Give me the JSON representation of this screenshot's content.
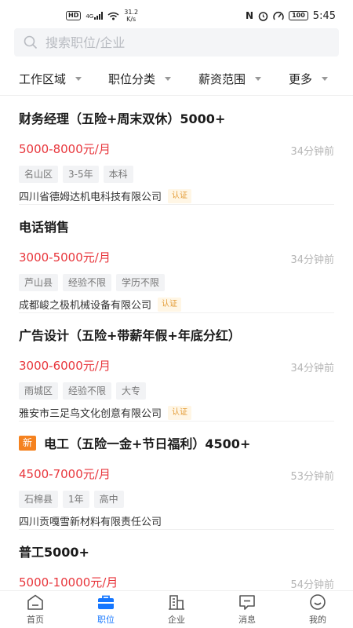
{
  "status_bar": {
    "hd": "HD",
    "net": "4G",
    "speed_value": "31.2",
    "speed_unit": "K/s",
    "nfc": "N",
    "battery": "100",
    "time": "5:45"
  },
  "search": {
    "placeholder": "搜索职位/企业"
  },
  "filters": [
    {
      "label": "工作区域"
    },
    {
      "label": "职位分类"
    },
    {
      "label": "薪资范围"
    },
    {
      "label": "更多"
    }
  ],
  "jobs": [
    {
      "title": "财务经理（五险+周末双休）5000+",
      "salary": "5000-8000元/月",
      "time": "34分钟前",
      "tags": [
        "名山区",
        "3-5年",
        "本科"
      ],
      "company": "四川省德姆达机电科技有限公司",
      "cert": "认证",
      "is_new": false
    },
    {
      "title": "电话销售",
      "salary": "3000-5000元/月",
      "time": "34分钟前",
      "tags": [
        "芦山县",
        "经验不限",
        "学历不限"
      ],
      "company": "成都峻之极机械设备有限公司",
      "cert": "认证",
      "is_new": false
    },
    {
      "title": "广告设计（五险+带薪年假+年底分红）",
      "salary": "3000-6000元/月",
      "time": "34分钟前",
      "tags": [
        "雨城区",
        "经验不限",
        "大专"
      ],
      "company": "雅安市三足鸟文化创意有限公司",
      "cert": "认证",
      "is_new": false
    },
    {
      "title": "电工（五险一金+节日福利）4500+",
      "salary": "4500-7000元/月",
      "time": "53分钟前",
      "tags": [
        "石棉县",
        "1年",
        "高中"
      ],
      "company": "四川贡嘎雪新材料有限责任公司",
      "cert": "",
      "is_new": true,
      "new_label": "新"
    },
    {
      "title": "普工5000+",
      "salary": "5000-10000元/月",
      "time": "54分钟前",
      "tags": [],
      "company": "",
      "cert": "",
      "is_new": false
    }
  ],
  "tabbar": [
    {
      "label": "首页",
      "icon": "home-icon",
      "active": false
    },
    {
      "label": "职位",
      "icon": "briefcase-icon",
      "active": true
    },
    {
      "label": "企业",
      "icon": "building-icon",
      "active": false
    },
    {
      "label": "消息",
      "icon": "message-icon",
      "active": false
    },
    {
      "label": "我的",
      "icon": "profile-icon",
      "active": false
    }
  ],
  "colors": {
    "accent": "#1677ff",
    "salary": "#e8363c",
    "new_badge": "#f5821f",
    "cert": "#e39b35"
  }
}
